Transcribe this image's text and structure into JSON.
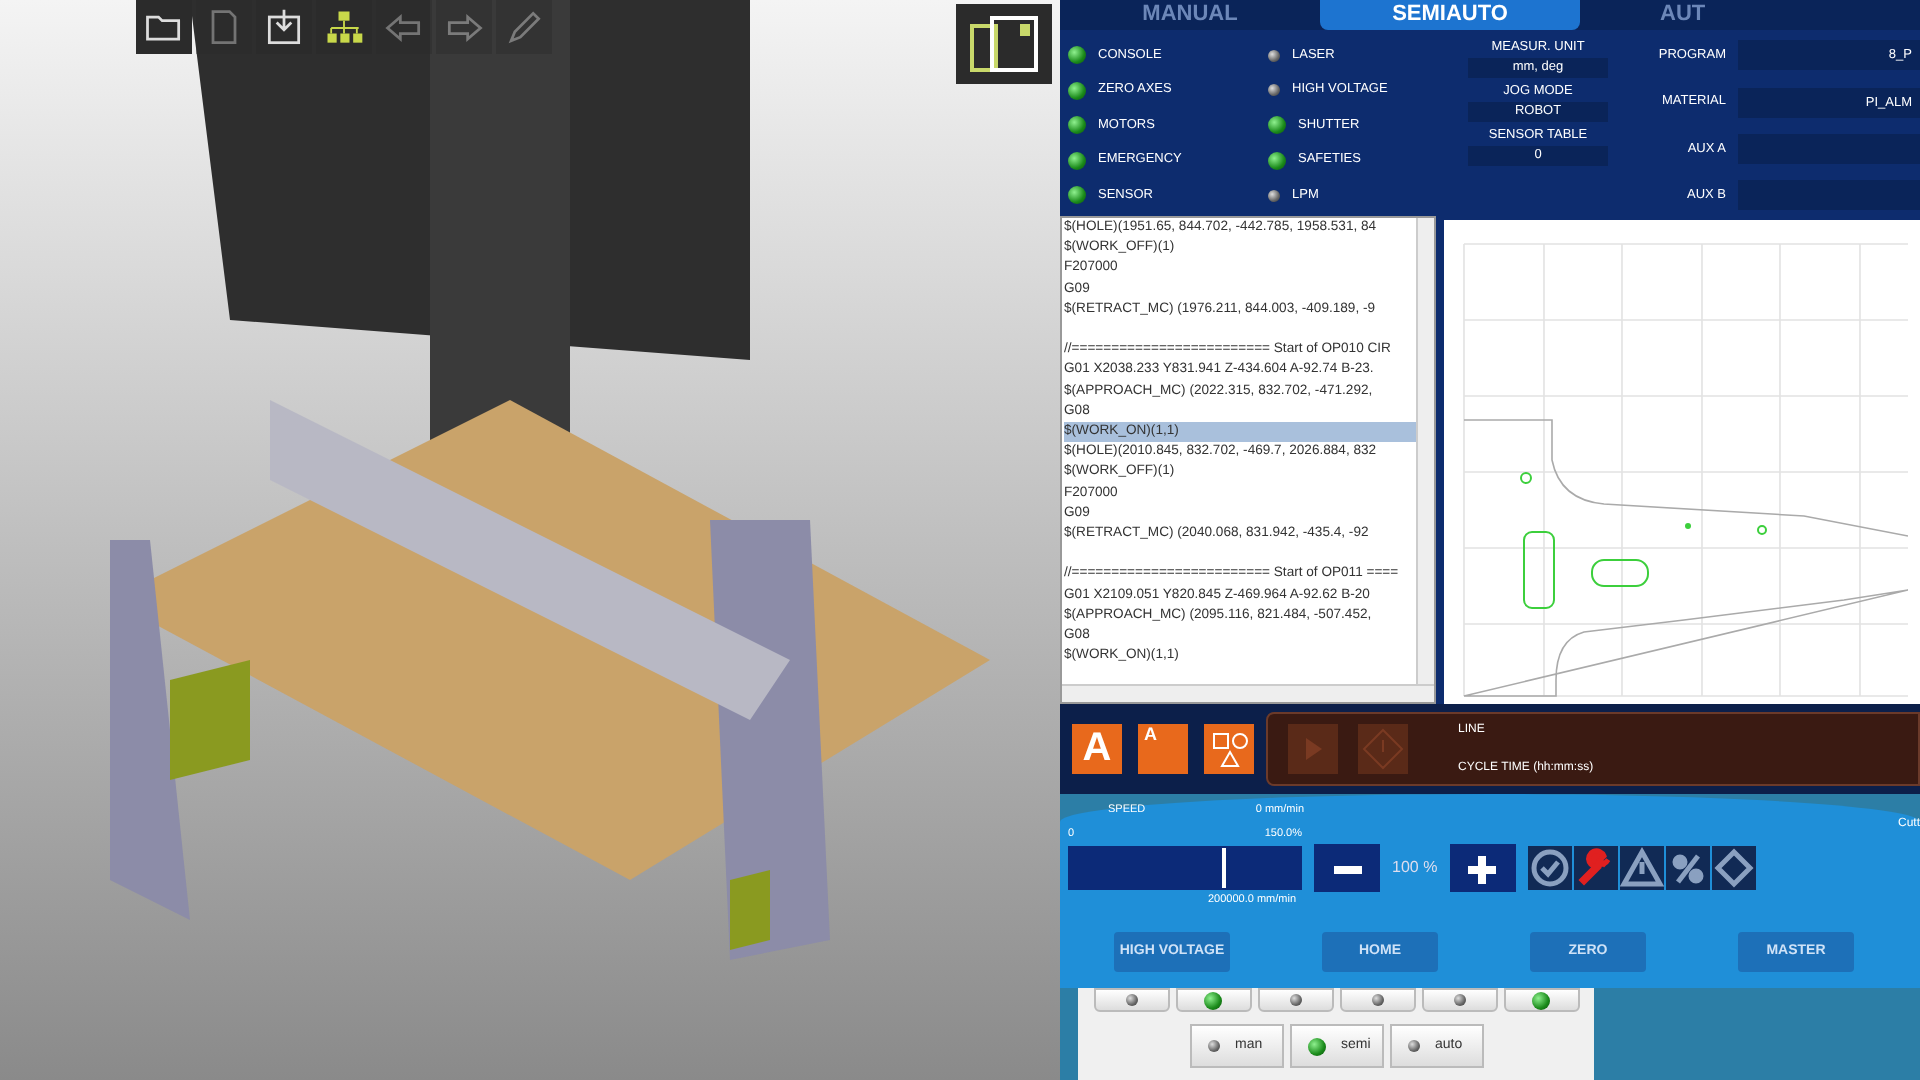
{
  "viewport": {
    "toolbar": [
      {
        "kind": "folder",
        "disabled": false
      },
      {
        "kind": "page",
        "disabled": true
      },
      {
        "kind": "import",
        "disabled": false
      },
      {
        "kind": "tree",
        "disabled": false
      },
      {
        "kind": "back",
        "disabled": true
      },
      {
        "kind": "forward",
        "disabled": true
      },
      {
        "kind": "pencil",
        "disabled": true
      }
    ]
  },
  "tabs": [
    {
      "label": "MANUAL",
      "selected": false
    },
    {
      "label": "SEMIAUTO",
      "selected": true
    },
    {
      "label": "AUT",
      "selected": false
    }
  ],
  "status_lamps": [
    {
      "label": "CONSOLE",
      "on": true
    },
    {
      "label": "ZERO AXES",
      "on": true
    },
    {
      "label": "MOTORS",
      "on": true
    },
    {
      "label": "EMERGENCY",
      "on": true
    },
    {
      "label": "SENSOR",
      "on": true
    },
    {
      "label": "LASER",
      "on": false
    },
    {
      "label": "HIGH VOLTAGE",
      "on": false
    },
    {
      "label": "SHUTTER",
      "on": true
    },
    {
      "label": "SAFETIES",
      "on": true
    },
    {
      "label": "LPM",
      "on": false
    }
  ],
  "settings": [
    {
      "label": "MEASUR. UNIT",
      "value": "mm, deg"
    },
    {
      "label": "JOG MODE",
      "value": "ROBOT"
    },
    {
      "label": "SENSOR TABLE",
      "value": "0"
    }
  ],
  "job_fields": [
    {
      "label": "PROGRAM",
      "value": "8_P"
    },
    {
      "label": "MATERIAL",
      "value": "PI_ALM"
    },
    {
      "label": "AUX A"
    },
    {
      "label": "AUX B"
    }
  ],
  "code_blocks": [
    [
      {
        "text": "$(HOLE)(1951.65, 844.702, -442.785, 1958.531, 84",
        "selected": false
      },
      {
        "text": "$(WORK_OFF)(1)",
        "selected": false
      },
      {
        "text": "F207000",
        "selected": false
      },
      {
        "text": "G09",
        "selected": false
      },
      {
        "text": "$(RETRACT_MC) (1976.211, 844.003, -409.189, -9",
        "selected": false
      }
    ],
    [
      {
        "text": "//========================= Start of OP010  CIR",
        "selected": false
      },
      {
        "text": "G01 X2038.233 Y831.941 Z-434.604 A-92.74 B-23.",
        "selected": false
      },
      {
        "text": "$(APPROACH_MC) (2022.315, 832.702, -471.292,",
        "selected": false
      },
      {
        "text": "G08",
        "selected": false
      },
      {
        "text": "$(WORK_ON)(1,1)",
        "selected": true
      },
      {
        "text": "$(HOLE)(2010.845, 832.702, -469.7, 2026.884, 832",
        "selected": false
      },
      {
        "text": "$(WORK_OFF)(1)",
        "selected": false
      },
      {
        "text": "F207000",
        "selected": false
      },
      {
        "text": "G09",
        "selected": false
      },
      {
        "text": "$(RETRACT_MC) (2040.068, 831.942, -435.4, -92",
        "selected": false
      }
    ],
    [
      {
        "text": "//========================= Start of OP011 ====",
        "selected": false
      },
      {
        "text": "G01 X2109.051 Y820.845 Z-469.964 A-92.62 B-20",
        "selected": false
      },
      {
        "text": "$(APPROACH_MC) (2095.116, 821.484, -507.452,",
        "selected": false
      },
      {
        "text": "G08",
        "selected": false
      },
      {
        "text": "$(WORK_ON)(1,1)",
        "selected": false
      }
    ]
  ],
  "mode_buttons": [
    {
      "kind": "letter",
      "label": "A"
    },
    {
      "kind": "split",
      "label": "A"
    },
    {
      "kind": "shapes"
    }
  ],
  "cycle": {
    "labels": [
      "LINE",
      "CYCLE TIME (hh:mm:ss)"
    ]
  },
  "speed": {
    "label": "SPEED",
    "reading": "0 mm/min",
    "min": "0",
    "max": "150.0%",
    "limit": "200000.0 mm/min",
    "level": 0.67,
    "override": "100 %"
  },
  "status_icons": [
    {
      "kind": "check",
      "color": "#8aa0c0"
    },
    {
      "kind": "wrench",
      "color": "#e02020"
    },
    {
      "kind": "warning",
      "color": "#8aa0c0"
    },
    {
      "kind": "percent",
      "color": "#8aa0c0"
    },
    {
      "kind": "diamond",
      "color": "#8aa0c0"
    }
  ],
  "side_label": "Cutt",
  "commands": [
    "HIGH VOLTAGE",
    "HOME",
    "ZERO",
    "MASTER"
  ],
  "io_lamps": [
    {
      "on": false
    },
    {
      "on": true
    },
    {
      "on": false
    },
    {
      "on": false
    },
    {
      "on": false
    },
    {
      "on": true
    }
  ],
  "mode_switch": [
    {
      "label": "man",
      "on": false
    },
    {
      "label": "semi",
      "on": true
    },
    {
      "label": "auto",
      "on": false
    }
  ]
}
